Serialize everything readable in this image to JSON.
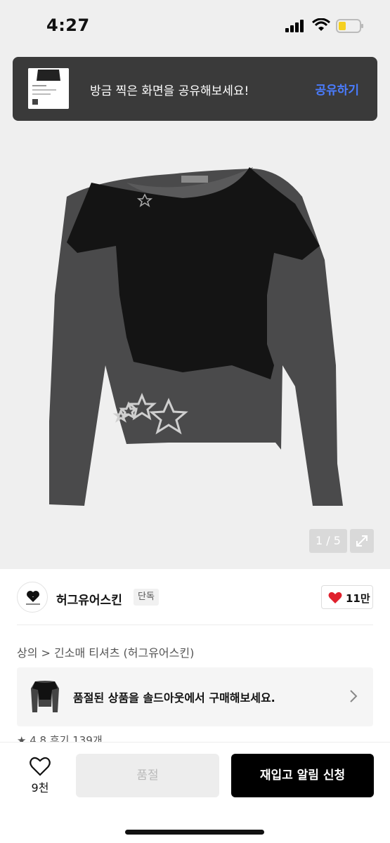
{
  "status_bar": {
    "time": "4:27"
  },
  "toast": {
    "message": "방금 찍은 화면을 공유해보세요!",
    "action_label": "공유하기",
    "action_color": "#4a7cff"
  },
  "gallery": {
    "pager": "1 / 5"
  },
  "brand": {
    "name": "허그유어스킨",
    "badge": "단독",
    "likes": "11만"
  },
  "breadcrumb": "상의 > 긴소매 티셔츠 (허그유어스킨)",
  "soldout_card": {
    "message": "품절된 상품을 솔드아웃에서 구매해보세요."
  },
  "rating": {
    "text": "★ 4.8 후기 139개"
  },
  "bottom_bar": {
    "wish_count": "9천",
    "soldout_label": "품절",
    "restock_label": "재입고 알림 신청"
  },
  "icons": [
    "signal-icon",
    "wifi-icon",
    "battery-icon",
    "expand-icon",
    "heart-icon",
    "chevron-right-icon",
    "star-icon"
  ]
}
